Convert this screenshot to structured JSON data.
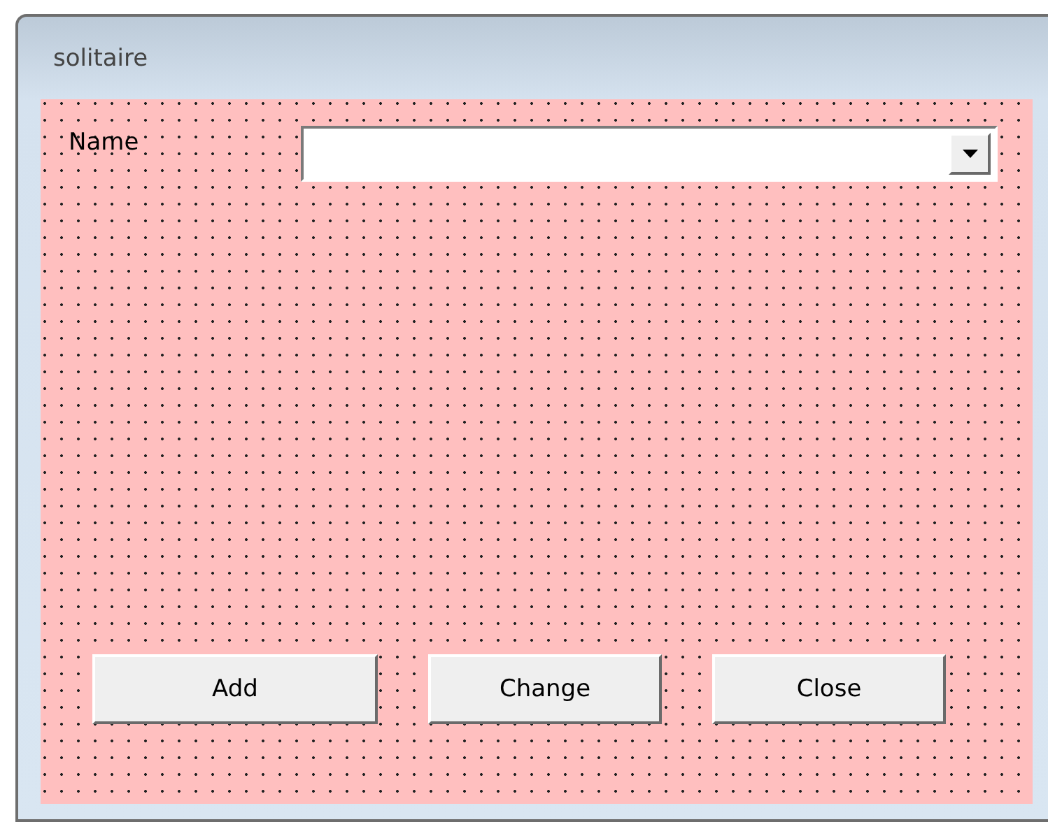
{
  "window": {
    "title": "solitaire"
  },
  "fields": [
    {
      "label": "Name",
      "kind": "combo"
    }
  ],
  "buttons": [
    "Add",
    "Change",
    "Close"
  ]
}
